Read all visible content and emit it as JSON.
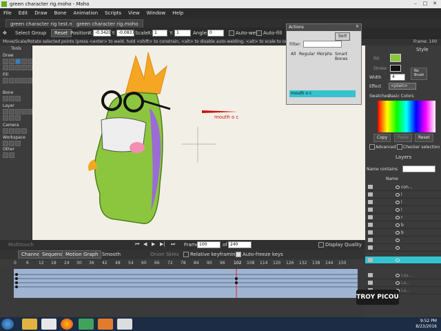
{
  "window": {
    "title": "green character rig.moho - Moho"
  },
  "menu": [
    "File",
    "Edit",
    "Draw",
    "Bone",
    "Animation",
    "Scripts",
    "View",
    "Window",
    "Help"
  ],
  "doc_tabs": [
    "green character rig test.moho",
    "green character rig.moho"
  ],
  "options_bar": {
    "select_group": "Select Group",
    "reset": "Reset",
    "position_label": "Position",
    "x_label": "X:",
    "x_value": "-0.3420",
    "y_label": "Y:",
    "y_value": "-0.0837",
    "scale_label": "Scale",
    "scale_x_label": "X:",
    "scale_x_value": "1",
    "scale_y_label": "Y:",
    "scale_y_value": "1",
    "angle_label": "Angle:",
    "angle_value": "0",
    "auto_weld": "Auto-weld",
    "auto_fill": "Auto-fill"
  },
  "status_text": "Move/Scale/Rotate selected points (press <enter> to weld, hold <shift> to constrain, <alt> to disable auto-welding, <alt> to scale to center, <shift> while",
  "frame_indicator": "Frame: 100",
  "tools_panel": {
    "title": "Tools",
    "sections": [
      "Draw",
      "Fill",
      "Bone",
      "Layer",
      "Camera",
      "Workspace",
      "Other"
    ]
  },
  "canvas": {
    "label": "mouth o c"
  },
  "playback": {
    "frame_label": "Frame",
    "frame_value": "100",
    "of_label": "of",
    "of_value": "240",
    "display_quality": "Display Quality"
  },
  "multitouch": "Multitouch",
  "timeline": {
    "tabs": [
      "Channels",
      "Sequencer",
      "Motion Graph"
    ],
    "smooth": "Smooth",
    "onion_skins": "Onion Skins",
    "relative_keyframing": "Relative keyframing",
    "auto_freeze": "Auto-freeze keys",
    "ticks": [
      "0",
      "6",
      "12",
      "18",
      "24",
      "30",
      "36",
      "42",
      "48",
      "54",
      "60",
      "66",
      "72",
      "78",
      "84",
      "90",
      "96",
      "102",
      "108",
      "114",
      "120",
      "126",
      "132",
      "138",
      "144",
      "150"
    ]
  },
  "actions": {
    "title": "Actions",
    "sort": "Sort",
    "filter": "Filter:",
    "columns": [
      "All",
      "Regular",
      "Morphs",
      "Smart Bones"
    ],
    "selected_action": "mouth o c"
  },
  "style_panel": {
    "title": "Style",
    "fill": "Fill",
    "stroke": "Stroke",
    "width_label": "Width",
    "width_value": "4",
    "no_brush": "No Brush",
    "effect_label": "Effect",
    "effect_value": "<plain>",
    "swatches_label": "Swatches",
    "swatches_value": "Basic Colors",
    "copy": "Copy",
    "paste": "Paste",
    "reset": "Reset",
    "advanced": "Advanced",
    "checker": "Checker selection"
  },
  "layers_panel": {
    "title": "Layers",
    "filter_placeholder": "Name contains",
    "name_col": "Name",
    "rows": [
      "con...",
      "l",
      "l",
      "l",
      "r",
      "b",
      "b",
      "",
      "",
      "",
      "Lay...",
      "La...",
      "La..."
    ]
  },
  "watermark": "TROY PICOU",
  "taskbar": {
    "time": "9:52 PM",
    "date": "8/23/2016"
  },
  "colors": {
    "character_green": "#8cc63f",
    "hair_orange": "#f5a623",
    "accent_cyan": "#35c3cf",
    "purple_shade": "#9b6bd6",
    "timeline_blue": "#9fb4d1"
  }
}
